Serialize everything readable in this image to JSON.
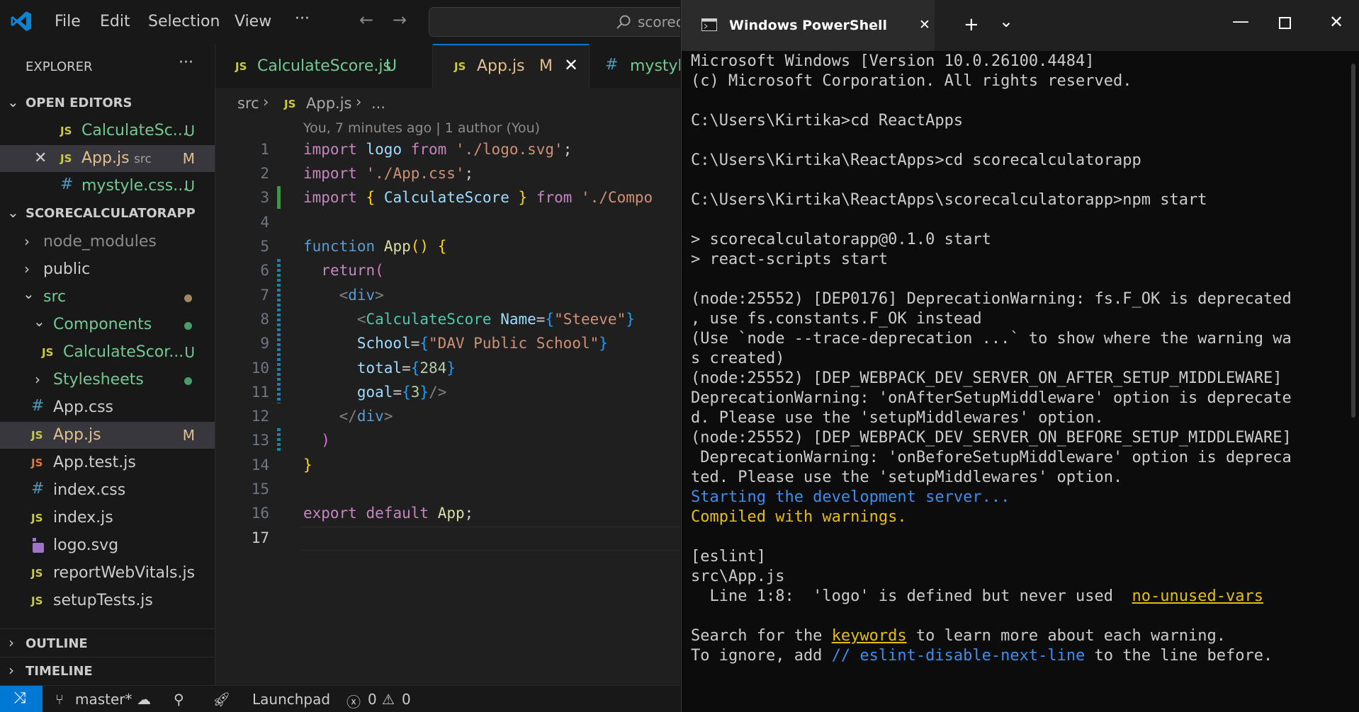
{
  "vscode": {
    "menu": [
      "File",
      "Edit",
      "Selection",
      "View",
      "···"
    ],
    "command_center": "scorec",
    "explorer_title": "EXPLORER",
    "explorer_more": "···",
    "open_editors_title": "OPEN EDITORS",
    "open_editors": [
      {
        "name": "CalculateSc...",
        "badge": "U",
        "icon": "JS"
      },
      {
        "name": "App.js",
        "path": "src",
        "badge": "M",
        "icon": "JS"
      },
      {
        "name": "mystyle.css...",
        "badge": "U",
        "icon": "#"
      }
    ],
    "project_title": "SCORECALCULATORAPP",
    "tree": [
      {
        "name": "node_modules"
      },
      {
        "name": "public"
      },
      {
        "name": "src"
      },
      {
        "name": "Components"
      },
      {
        "name": "CalculateScor...",
        "badge": "U",
        "icon": "JS"
      },
      {
        "name": "Stylesheets"
      },
      {
        "name": "App.css",
        "icon": "#"
      },
      {
        "name": "App.js",
        "badge": "M",
        "icon": "JS"
      },
      {
        "name": "App.test.js",
        "icon": "JS"
      },
      {
        "name": "index.css",
        "icon": "#"
      },
      {
        "name": "index.js",
        "icon": "JS"
      },
      {
        "name": "logo.svg"
      },
      {
        "name": "reportWebVitals.js",
        "icon": "JS"
      },
      {
        "name": "setupTests.js",
        "icon": "JS"
      }
    ],
    "outline_title": "OUTLINE",
    "timeline_title": "TIMELINE",
    "tabs": [
      {
        "name": "CalculateScore.js",
        "badge": "U",
        "icon": "JS"
      },
      {
        "name": "App.js",
        "badge": "M",
        "icon": "JS"
      },
      {
        "name": "mystyle",
        "icon": "#"
      }
    ],
    "breadcrumb": [
      "src",
      "App.js",
      "..."
    ],
    "breadcrumb_js": "JS",
    "blame": "You, 7 minutes ago | 1 author (You)",
    "line_numbers": [
      "1",
      "2",
      "3",
      "4",
      "5",
      "6",
      "7",
      "8",
      "9",
      "10",
      "11",
      "12",
      "13",
      "14",
      "15",
      "16",
      "17"
    ],
    "code": {
      "l1": [
        "import",
        "logo",
        "from",
        "'./logo.svg'",
        ";"
      ],
      "l2": [
        "import",
        "'./App.css'",
        ";"
      ],
      "l3": [
        "import",
        "{",
        "CalculateScore",
        "}",
        "from",
        "'./Compo"
      ],
      "l5": [
        "function",
        "App",
        "()",
        "{"
      ],
      "l6": [
        "return",
        "("
      ],
      "l7": [
        "<",
        "div",
        ">"
      ],
      "l8": [
        "<",
        "CalculateScore",
        "Name",
        "=",
        "{",
        "\"Steeve\"",
        "}"
      ],
      "l9": [
        "School",
        "=",
        "{",
        "\"DAV Public School\"",
        "}"
      ],
      "l10": [
        "total",
        "=",
        "{",
        "284",
        "}"
      ],
      "l11": [
        "goal",
        "=",
        "{",
        "3",
        "}",
        "/>"
      ],
      "l12": [
        "</",
        "div",
        ">"
      ],
      "l13": [
        ")"
      ],
      "l14": [
        "}"
      ],
      "l16": [
        "export",
        "default",
        "App",
        ";"
      ]
    },
    "status": {
      "branch": "master*",
      "launchpad": "Launchpad",
      "errors": "0",
      "warnings": "0"
    }
  },
  "terminal": {
    "title": "Windows PowerShell",
    "lines": [
      "Microsoft Windows [Version 10.0.26100.4484]",
      "(c) Microsoft Corporation. All rights reserved.",
      "",
      "C:\\Users\\Kirtika>cd ReactApps",
      "",
      "C:\\Users\\Kirtika\\ReactApps>cd scorecalculatorapp",
      "",
      "C:\\Users\\Kirtika\\ReactApps\\scorecalculatorapp>npm start",
      "",
      "> scorecalculatorapp@0.1.0 start",
      "> react-scripts start",
      "",
      "(node:25552) [DEP0176] DeprecationWarning: fs.F_OK is deprecated",
      ", use fs.constants.F_OK instead",
      "(Use `node --trace-deprecation ...` to show where the warning wa",
      "s created)",
      "(node:25552) [DEP_WEBPACK_DEV_SERVER_ON_AFTER_SETUP_MIDDLEWARE]",
      "DeprecationWarning: 'onAfterSetupMiddleware' option is deprecate",
      "d. Please use the 'setupMiddlewares' option.",
      "(node:25552) [DEP_WEBPACK_DEV_SERVER_ON_BEFORE_SETUP_MIDDLEWARE]",
      " DeprecationWarning: 'onBeforeSetupMiddleware' option is depreca",
      "ted. Please use the 'setupMiddlewares' option."
    ],
    "starting": "Starting the development server...",
    "compiled": "Compiled with warnings.",
    "eslint": "[eslint]",
    "file": "src\\App.js",
    "warn_prefix": "  Line 1:8:  'logo' is defined but never used  ",
    "warn_rule": "no-unused-vars",
    "search_pre": "Search for the ",
    "search_link": "keywords",
    "search_post": " to learn more about each warning.",
    "ignore_pre": "To ignore, add ",
    "ignore_link": "// eslint-disable-next-line",
    "ignore_post": " to the line before."
  }
}
